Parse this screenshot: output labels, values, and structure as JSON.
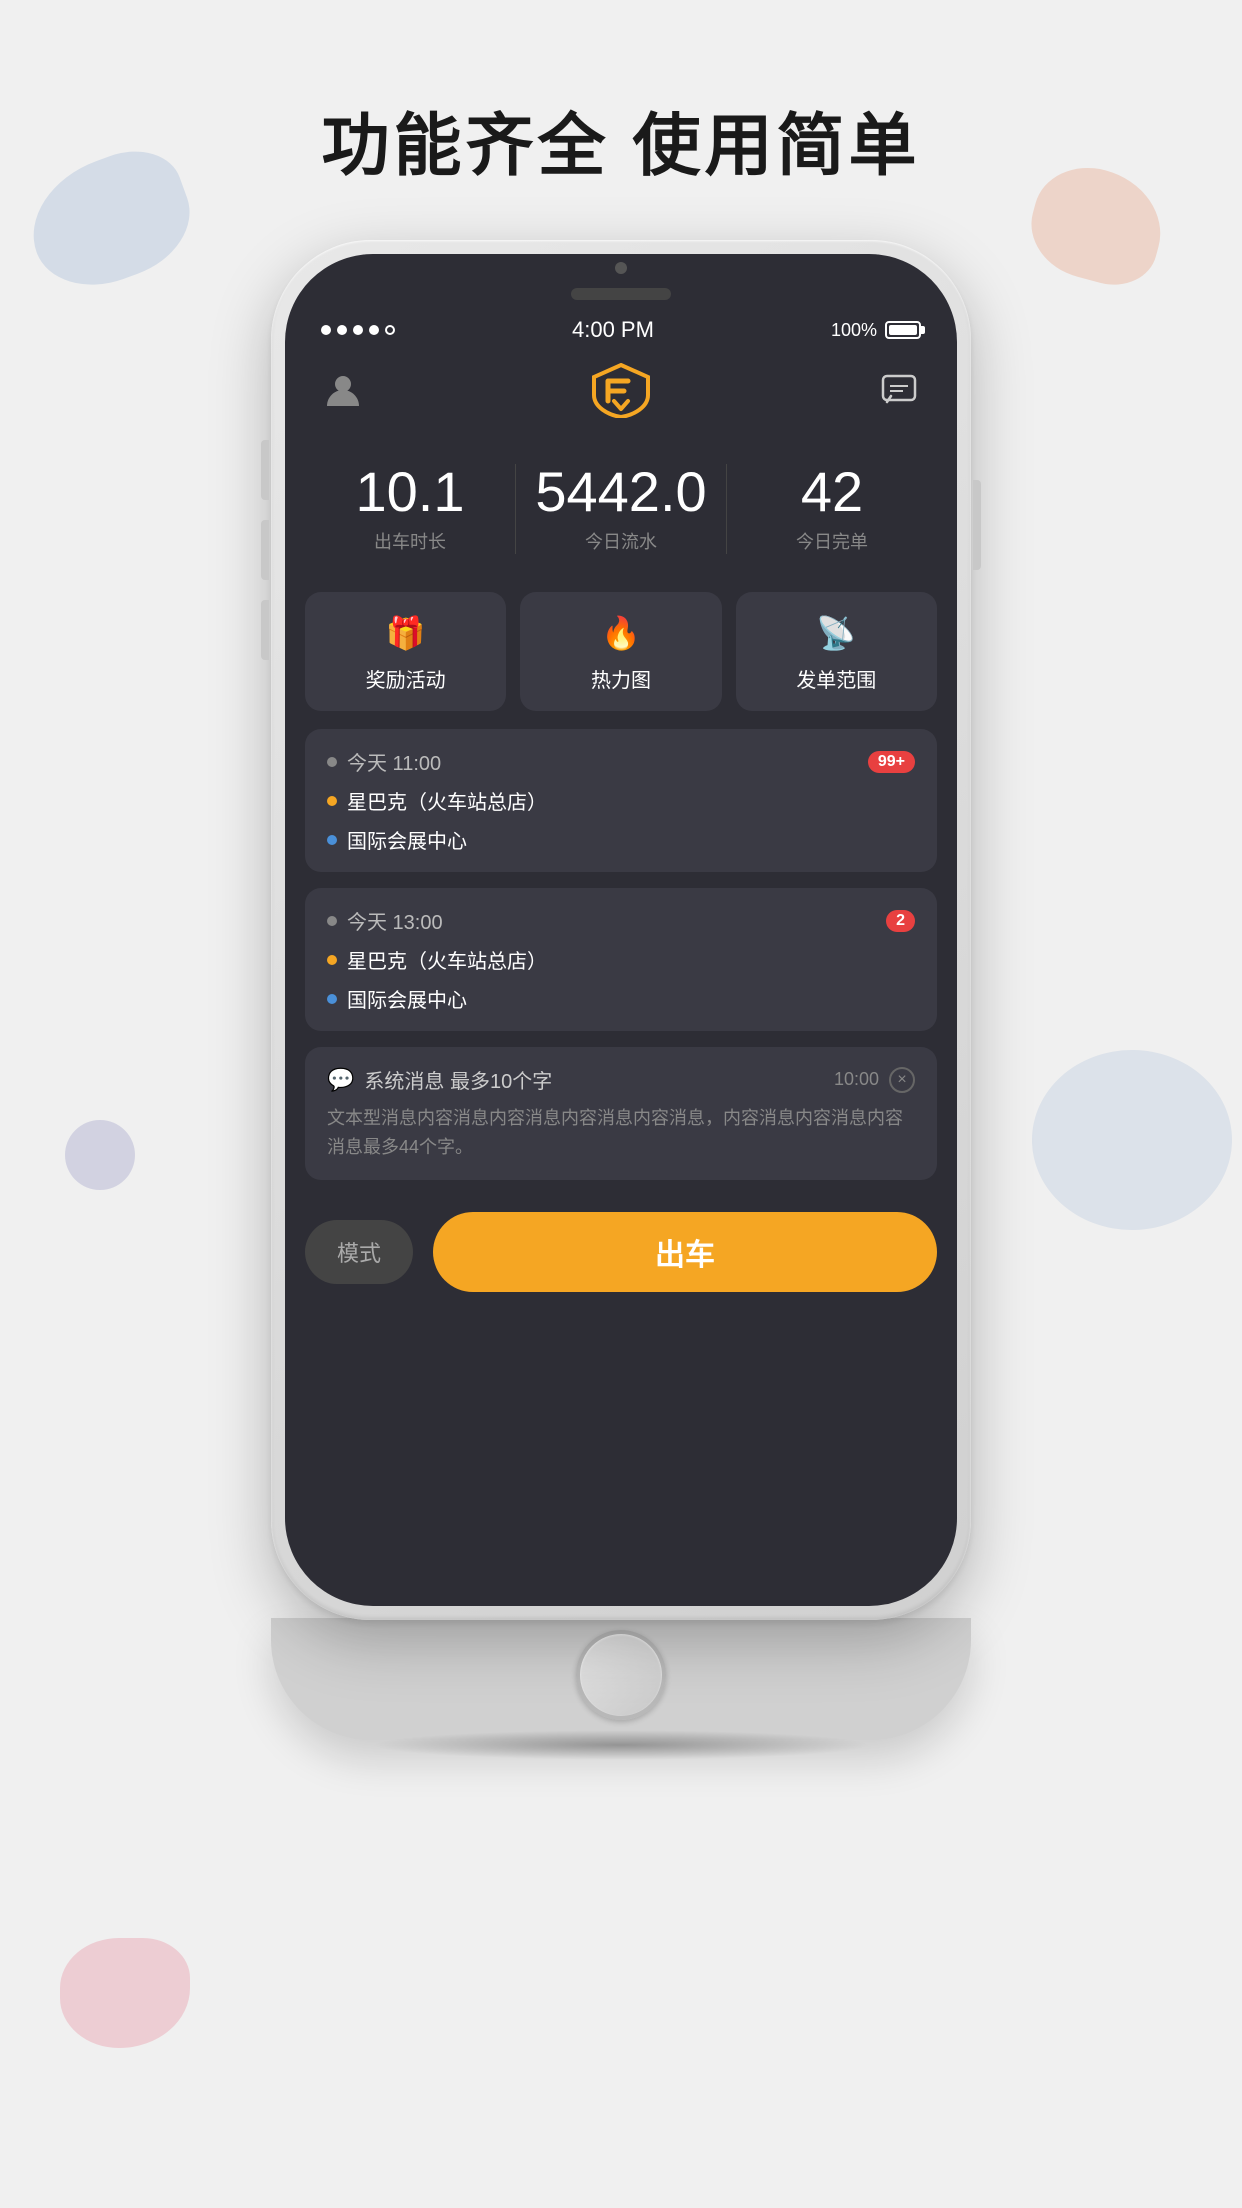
{
  "page": {
    "title": "功能齐全  使用简单",
    "background_color": "#f0f0f0"
  },
  "status_bar": {
    "dots": [
      "filled",
      "filled",
      "filled",
      "filled",
      "empty"
    ],
    "time": "4:00 PM",
    "battery_percent": "100%"
  },
  "header": {
    "logo_alt": "Driver App Logo",
    "user_icon": "👤",
    "message_icon": "💬"
  },
  "stats": [
    {
      "value": "10.1",
      "label": "出车时长"
    },
    {
      "value": "5442.0",
      "label": "今日流水"
    },
    {
      "value": "42",
      "label": "今日完单"
    }
  ],
  "actions": [
    {
      "icon": "🎁",
      "label": "奖励活动"
    },
    {
      "icon": "🔥",
      "label": "热力图"
    },
    {
      "icon": "📡",
      "label": "发单范围"
    }
  ],
  "orders": [
    {
      "time": "今天  11:00",
      "badge": "99+",
      "from": "星巴克（火车站总店）",
      "to": "国际会展中心"
    },
    {
      "time": "今天  13:00",
      "badge": "2",
      "from": "星巴克（火车站总店）",
      "to": "国际会展中心"
    }
  ],
  "system_message": {
    "title": "系统消息  最多10个字",
    "time": "10:00",
    "content": "文本型消息内容消息内容消息内容消息内容消息，内容消息内容消息内容消息最多44个字。"
  },
  "bottom_bar": {
    "mode_label": "模式",
    "go_label": "出车"
  }
}
